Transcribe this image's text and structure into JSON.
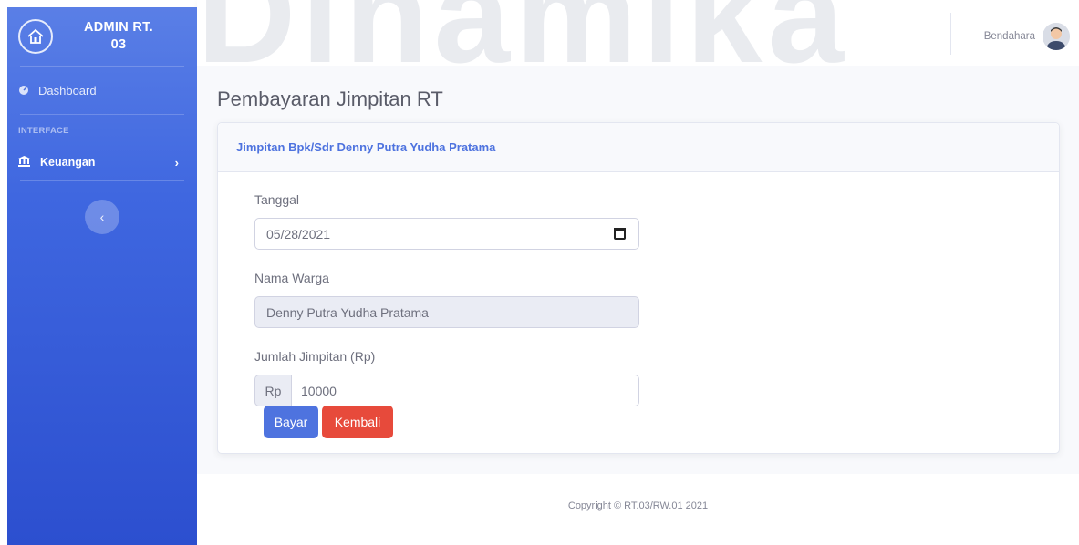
{
  "brand": {
    "title_line1": "ADMIN RT.",
    "title_line2": "03"
  },
  "sidebar": {
    "dashboard_label": "Dashboard",
    "heading": "INTERFACE",
    "keuangan_label": "Keuangan",
    "toggle_glyph": "‹"
  },
  "watermark": "Dinamika",
  "topbar": {
    "user_name": "Bendahara"
  },
  "page": {
    "title": "Pembayaran Jimpitan RT"
  },
  "card": {
    "header": "Jimpitan Bpk/Sdr Denny Putra Yudha Pratama"
  },
  "form": {
    "tanggal_label": "Tanggal",
    "tanggal_value": "05/28/2021",
    "nama_label": "Nama Warga",
    "nama_value": "Denny Putra Yudha Pratama",
    "jumlah_label": "Jumlah Jimpitan (Rp)",
    "jumlah_prefix": "Rp",
    "jumlah_value": "10000"
  },
  "buttons": {
    "bayar": "Bayar",
    "kembali": "Kembali"
  },
  "footer": {
    "copyright": "Copyright © RT.03/RW.01 2021"
  },
  "colors": {
    "primary": "#4e73df",
    "danger": "#e74a3b",
    "sidebar_top": "#5a7fe6",
    "sidebar_bottom": "#2c4fcf"
  },
  "icons": {
    "brand": "house-logo-icon",
    "dashboard": "dashboard-icon",
    "keuangan": "bank-icon",
    "chevron": "chevron-right-icon"
  }
}
